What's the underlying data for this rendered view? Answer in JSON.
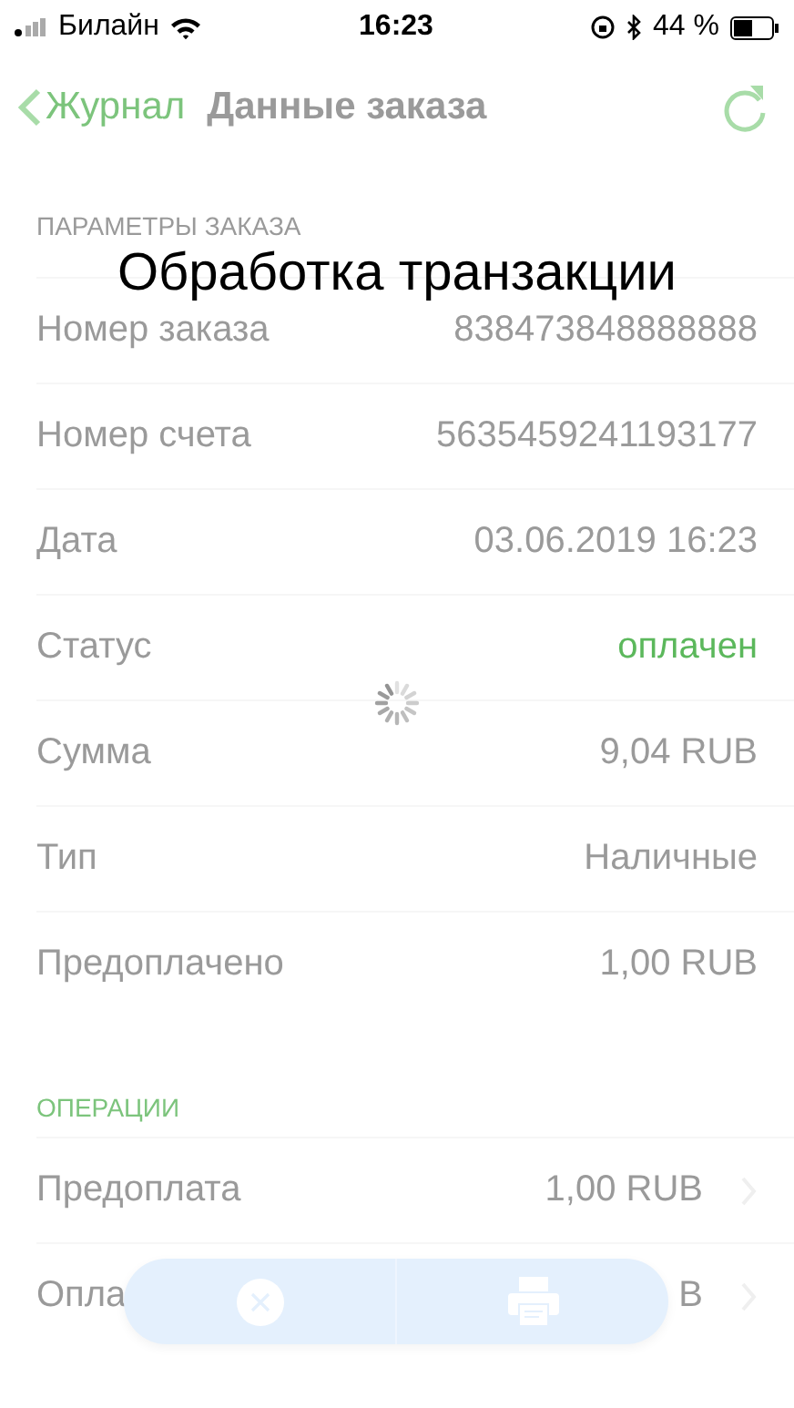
{
  "status_bar": {
    "carrier": "Билайн",
    "time": "16:23",
    "battery": "44 %"
  },
  "nav": {
    "back": "Журнал",
    "title": "Данные заказа"
  },
  "overlay": {
    "title": "Обработка транзакции"
  },
  "sections": [
    {
      "header": "ПАРАМЕТРЫ ЗАКАЗА",
      "rows": [
        {
          "label": "Номер заказа",
          "value": "838473848888888",
          "kind": "plain"
        },
        {
          "label": "Номер счета",
          "value": "5635459241193177",
          "kind": "plain"
        },
        {
          "label": "Дата",
          "value": "03.06.2019 16:23",
          "kind": "plain"
        },
        {
          "label": "Статус",
          "value": "оплачен",
          "kind": "status"
        },
        {
          "label": "Сумма",
          "value": "9,04 RUB",
          "kind": "plain"
        },
        {
          "label": "Тип",
          "value": "Наличные",
          "kind": "plain"
        },
        {
          "label": "Предоплачено",
          "value": "1,00 RUB",
          "kind": "plain"
        }
      ]
    },
    {
      "header": "ОПЕРАЦИИ",
      "rows": [
        {
          "label": "Предоплата",
          "value": "1,00 RUB",
          "kind": "link"
        },
        {
          "label": "Опла",
          "value": "B",
          "kind": "link"
        }
      ]
    }
  ]
}
